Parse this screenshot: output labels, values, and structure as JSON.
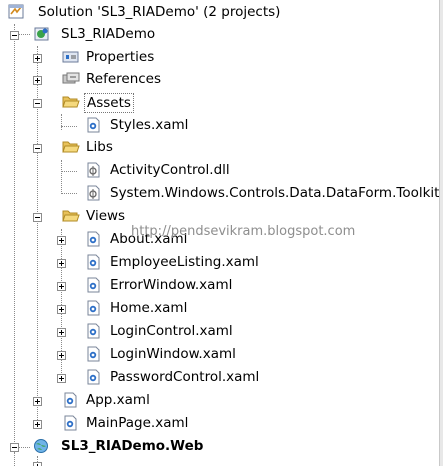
{
  "tree": {
    "nodes": [
      {
        "id": "solution",
        "label": "Solution 'SL3_RIADemo' (2 projects)",
        "icon": "solution-icon",
        "state": "none"
      },
      {
        "id": "project-sl3",
        "label": "SL3_RIADemo",
        "icon": "silverlight-project-icon",
        "state": "expanded",
        "bold": false
      },
      {
        "id": "properties",
        "label": "Properties",
        "icon": "properties-icon",
        "state": "collapsed"
      },
      {
        "id": "references",
        "label": "References",
        "icon": "references-icon",
        "state": "collapsed"
      },
      {
        "id": "assets",
        "label": "Assets",
        "icon": "folder-icon",
        "state": "expanded"
      },
      {
        "id": "styles",
        "label": "Styles.xaml",
        "icon": "xaml-icon",
        "state": "none"
      },
      {
        "id": "libs",
        "label": "Libs",
        "icon": "folder-icon",
        "state": "expanded"
      },
      {
        "id": "activitycontrol",
        "label": "ActivityControl.dll",
        "icon": "dll-icon",
        "state": "none"
      },
      {
        "id": "dataform",
        "label": "System.Windows.Controls.Data.DataForm.Toolkit",
        "icon": "dll-icon",
        "state": "none"
      },
      {
        "id": "views",
        "label": "Views",
        "icon": "folder-icon",
        "state": "expanded"
      },
      {
        "id": "about",
        "label": "About.xaml",
        "icon": "xaml-icon",
        "state": "collapsed"
      },
      {
        "id": "employeelisting",
        "label": "EmployeeListing.xaml",
        "icon": "xaml-icon",
        "state": "collapsed"
      },
      {
        "id": "errorwindow",
        "label": "ErrorWindow.xaml",
        "icon": "xaml-icon",
        "state": "collapsed"
      },
      {
        "id": "home",
        "label": "Home.xaml",
        "icon": "xaml-icon",
        "state": "collapsed"
      },
      {
        "id": "logincontrol",
        "label": "LoginControl.xaml",
        "icon": "xaml-icon",
        "state": "collapsed"
      },
      {
        "id": "loginwindow",
        "label": "LoginWindow.xaml",
        "icon": "xaml-icon",
        "state": "collapsed"
      },
      {
        "id": "passwordcontrol",
        "label": "PasswordControl.xaml",
        "icon": "xaml-icon",
        "state": "collapsed"
      },
      {
        "id": "app",
        "label": "App.xaml",
        "icon": "xaml-icon",
        "state": "collapsed"
      },
      {
        "id": "mainpage",
        "label": "MainPage.xaml",
        "icon": "xaml-icon",
        "state": "collapsed"
      },
      {
        "id": "project-web",
        "label": "SL3_RIADemo.Web",
        "icon": "web-project-icon",
        "state": "expanded",
        "bold": true
      }
    ]
  },
  "watermark": "http://pendsevikram.blogspot.com",
  "colors": {
    "folder": "#e8c15a",
    "xaml": "#2d6fc7",
    "selection_border": "#777777",
    "tree_lines": "#8a8a8a"
  }
}
